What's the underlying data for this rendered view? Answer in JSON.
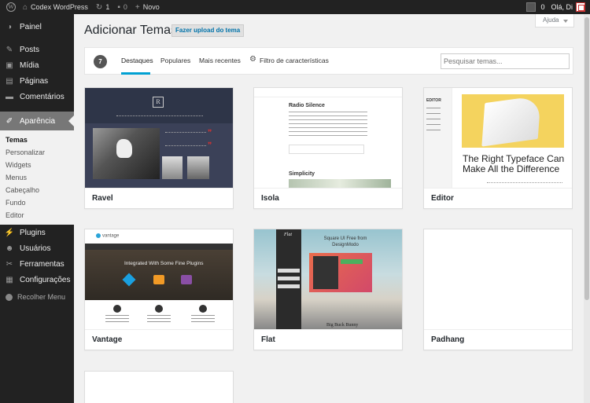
{
  "adminbar": {
    "site_name": "Codex WordPress",
    "updates_count": "1",
    "comments_count": "0",
    "new_label": "Novo",
    "notif_count": "0",
    "greeting": "Olá, Di"
  },
  "sidebar": {
    "items": [
      {
        "label": "Painel",
        "icon": "dashboard-icon"
      },
      {
        "label": "Posts",
        "icon": "pin-icon"
      },
      {
        "label": "Mídia",
        "icon": "media-icon"
      },
      {
        "label": "Páginas",
        "icon": "page-icon"
      },
      {
        "label": "Comentários",
        "icon": "comment-icon"
      },
      {
        "label": "Aparência",
        "icon": "brush-icon"
      },
      {
        "label": "Plugins",
        "icon": "plug-icon"
      },
      {
        "label": "Usuários",
        "icon": "users-icon"
      },
      {
        "label": "Ferramentas",
        "icon": "wrench-icon"
      },
      {
        "label": "Configurações",
        "icon": "settings-icon"
      }
    ],
    "submenu": [
      "Temas",
      "Personalizar",
      "Widgets",
      "Menus",
      "Cabeçalho",
      "Fundo",
      "Editor"
    ],
    "collapse": "Recolher Menu"
  },
  "page": {
    "title": "Adicionar Temas",
    "upload_button": "Fazer upload do tema",
    "help": "Ajuda"
  },
  "filter": {
    "count": "7",
    "tabs": [
      "Destaques",
      "Populares",
      "Mais recentes"
    ],
    "feature_filter": "Filtro de características",
    "search_placeholder": "Pesquisar temas..."
  },
  "themes": [
    {
      "name": "Ravel"
    },
    {
      "name": "Isola"
    },
    {
      "name": "Editor"
    },
    {
      "name": "Vantage"
    },
    {
      "name": "Flat"
    },
    {
      "name": "Padhang"
    }
  ],
  "previews": {
    "isola_title": "Radio Silence",
    "isola_title2": "Simplicity",
    "editor_label": "EDITOR",
    "editor_headline": "The Right Typeface Can Make All the Difference",
    "vantage_logo": "vantage",
    "vantage_hero": "Integrated With Some Fine Plugins",
    "flat_title": "Flat",
    "flat_heading": "Square UI Free from DesignModo",
    "flat_footer": "Big Buck Bunny"
  },
  "colors": {
    "accent": "#00a0d2",
    "sidebar_bg": "#222222",
    "current_menu": "#777777"
  }
}
